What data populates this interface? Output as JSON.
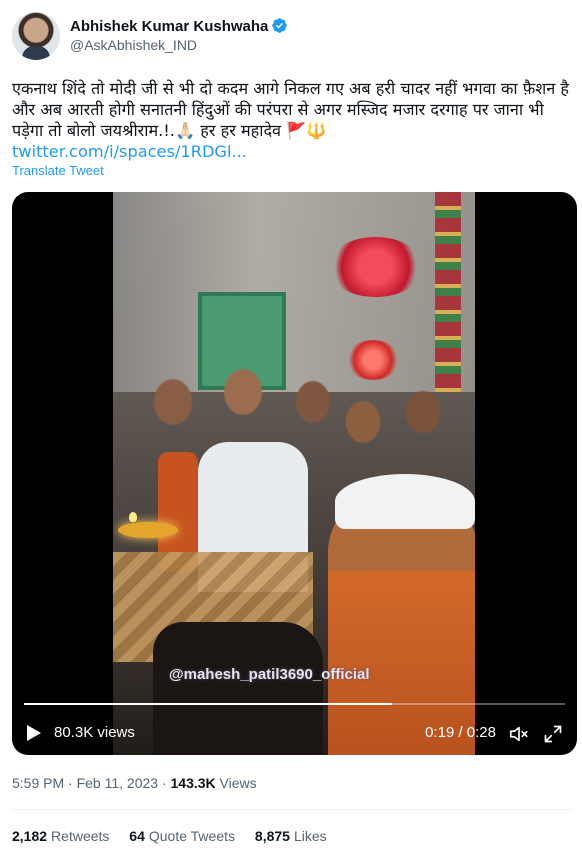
{
  "author": {
    "name": "Abhishek Kumar Kushwaha",
    "handle": "@AskAbhishek_IND",
    "verified": true
  },
  "tweet": {
    "text": "एकनाथ शिंदे तो मोदी जी से भी दो कदम आगे निकल गए अब हरी चादर नहीं भगवा का फ़ैशन है और अब आरती होगी सनातनी हिंदुओं की परंपरा से अगर मस्जिद मजार दरगाह पर जाना भी पड़ेगा तो बोलो जयश्रीराम.!.🙏🏻 हर हर महादेव 🚩🔱",
    "link": "twitter.com/i/spaces/1RDGl...",
    "translate_label": "Translate Tweet"
  },
  "video": {
    "watermark": "@mahesh_patil3690_official",
    "views": "80.3K views",
    "time": "0:19 / 0:28",
    "progress": 0.68
  },
  "meta": {
    "time": "5:59 PM · Feb 11, 2023",
    "sep": " · ",
    "views_count": "143.3K",
    "views_label": " Views"
  },
  "stats": [
    {
      "count": "2,182",
      "label": "Retweets"
    },
    {
      "count": "64",
      "label": "Quote Tweets"
    },
    {
      "count": "8,875",
      "label": "Likes"
    }
  ],
  "colors": {
    "link": "#1d9bf0",
    "secondary": "#536471",
    "verified": "#1d9bf0"
  }
}
